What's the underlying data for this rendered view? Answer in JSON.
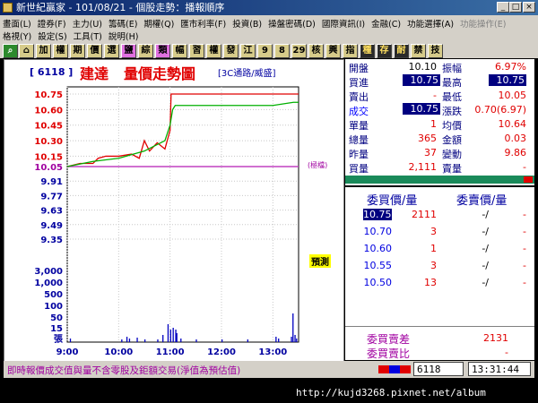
{
  "window": {
    "title": "新世紀贏家 - 101/08/21 - 個股走勢：播報順序"
  },
  "menu_row1": [
    "畫面(L)",
    "證券(F)",
    "主力(U)",
    "籌碼(E)",
    "期權(Q)",
    "匯市利率(F)",
    "投資(B)",
    "操盤密碼(D)",
    "國際資訊(I)",
    "金融(C)",
    "功能選擇(A)",
    "功能操作(E)"
  ],
  "menu_row2": [
    "格視(Y)",
    "設定(S)",
    "工具(T)",
    "說明(H)"
  ],
  "toolbar": [
    "加",
    "權",
    "期",
    "價",
    "選",
    "鹽",
    "綜",
    "類",
    "幅",
    "習",
    "權",
    "發",
    "江",
    "9",
    "8",
    "29",
    "核",
    "興",
    "指",
    "種",
    "存",
    "耐",
    "禁",
    "技"
  ],
  "chart": {
    "stock_id": "[ 6118 ]",
    "name": "建達",
    "title": "量價走勢圖",
    "subtitle": "[3C通路/威盛]",
    "ref_label": "(極檔)",
    "yellow_label": "預測",
    "price_ticks": [
      "10.75",
      "10.60",
      "10.45",
      "10.30",
      "10.15",
      "10.05",
      "9.91",
      "9.77",
      "9.63",
      "9.49",
      "9.35"
    ],
    "volume_ticks": [
      "3,000",
      "1,000",
      "500",
      "100",
      "50",
      "15",
      "張"
    ],
    "time_ticks": [
      "9:00",
      "10:00",
      "11:00",
      "12:00",
      "13:00"
    ]
  },
  "chart_data": {
    "type": "line",
    "title": "量價走勢圖",
    "x": [
      "9:00",
      "10:00",
      "11:00",
      "12:00",
      "13:00"
    ],
    "ylim": [
      9.35,
      10.75
    ],
    "series": [
      {
        "name": "",
        "color": "#e00000",
        "x": [
          0.0,
          0.25,
          0.5,
          0.6,
          0.75,
          1.0,
          1.25,
          1.4,
          1.5,
          1.6,
          1.75,
          1.9,
          2.0,
          2.02,
          2.05,
          2.1,
          2.3,
          2.5,
          3.0,
          3.5,
          4.0,
          4.5
        ],
        "y": [
          10.05,
          10.08,
          10.08,
          10.13,
          10.15,
          10.15,
          10.17,
          10.13,
          10.3,
          10.2,
          10.28,
          10.22,
          10.4,
          10.75,
          10.75,
          10.75,
          10.75,
          10.75,
          10.75,
          10.75,
          10.75,
          10.75
        ]
      },
      {
        "name": "",
        "color": "#00b000",
        "x": [
          0.0,
          0.5,
          1.0,
          1.5,
          1.9,
          2.0,
          2.05,
          2.1,
          2.3,
          2.5,
          3.0,
          3.5,
          4.0,
          4.4,
          4.5
        ],
        "y": [
          10.05,
          10.1,
          10.13,
          10.2,
          10.3,
          10.45,
          10.6,
          10.64,
          10.64,
          10.64,
          10.64,
          10.64,
          10.64,
          10.67,
          10.67
        ]
      }
    ]
  },
  "quote": {
    "open": {
      "label": "開盤",
      "value": "10.10"
    },
    "amplitude": {
      "label": "振幅",
      "value": "6.97%"
    },
    "bid": {
      "label": "買進",
      "value": "10.75"
    },
    "high": {
      "label": "最高",
      "value": "10.75"
    },
    "ask": {
      "label": "賣出",
      "value": "-"
    },
    "low": {
      "label": "最低",
      "value": "10.05"
    },
    "last": {
      "label": "成交",
      "value": "10.75"
    },
    "change": {
      "label": "漲跌",
      "value": "0.70(6.97)"
    },
    "tick_vol": {
      "label": "單量",
      "value": "1"
    },
    "avg": {
      "label": "均價",
      "value": "10.64"
    },
    "total_vol": {
      "label": "總量",
      "value": "365"
    },
    "amount": {
      "label": "金額",
      "value": "0.03"
    },
    "yest_vol": {
      "label": "昨量",
      "value": "37"
    },
    "variation": {
      "label": "變動",
      "value": "9.86"
    },
    "buy_vol": {
      "label": "買量",
      "value": "2,111"
    },
    "sell_vol": {
      "label": "賣量",
      "value": "-"
    }
  },
  "orderbook": {
    "bid_header": "委買價/量",
    "ask_header": "委賣價/量",
    "rows": [
      {
        "bid_price": "10.75",
        "bid_qty": "2111",
        "ask_price": "-/",
        "ask_qty": "-"
      },
      {
        "bid_price": "10.70",
        "bid_qty": "3",
        "ask_price": "-/",
        "ask_qty": "-"
      },
      {
        "bid_price": "10.60",
        "bid_qty": "1",
        "ask_price": "-/",
        "ask_qty": "-"
      },
      {
        "bid_price": "10.55",
        "bid_qty": "3",
        "ask_price": "-/",
        "ask_qty": "-"
      },
      {
        "bid_price": "10.50",
        "bid_qty": "13",
        "ask_price": "-/",
        "ask_qty": "-"
      }
    ],
    "diff_label": "委買賣差",
    "diff_value": "2131",
    "ratio_label": "委買賣比",
    "ratio_value": "-"
  },
  "status": {
    "note": "即時報價成交值與量不含零股及鉅額交易(淨值為預估值)",
    "code": "6118",
    "time": "13:31:44"
  },
  "watermark": "http://kujd3268.pixnet.net/album"
}
